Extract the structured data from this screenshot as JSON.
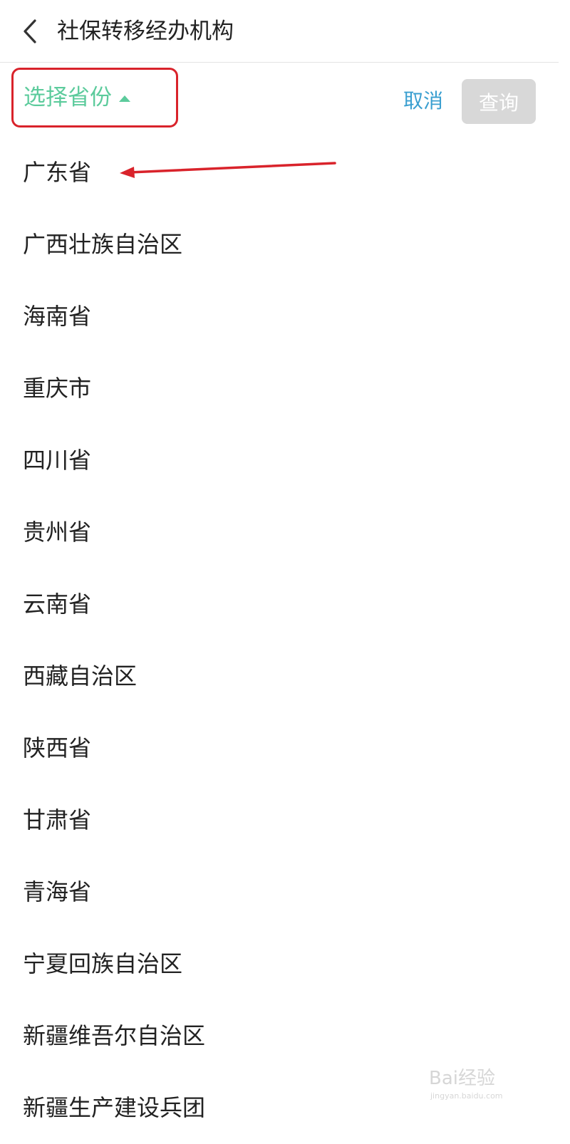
{
  "header": {
    "back_icon": "chevron-left-icon",
    "title": "社保转移经办机构"
  },
  "toolbar": {
    "select_label": "选择省份",
    "select_icon": "caret-up-icon",
    "cancel_label": "取消",
    "query_label": "查询"
  },
  "provinces": [
    "广东省",
    "广西壮族自治区",
    "海南省",
    "重庆市",
    "四川省",
    "贵州省",
    "云南省",
    "西藏自治区",
    "陕西省",
    "甘肃省",
    "青海省",
    "宁夏回族自治区",
    "新疆维吾尔自治区",
    "新疆生产建设兵团"
  ],
  "colors": {
    "accent_green": "#5ccb9c",
    "link_blue": "#3a9fd0",
    "annotation_red": "#d9232b",
    "disabled_button": "#d8d8d8"
  },
  "watermark": {
    "brand": "Bai经验",
    "url": "jingyan.baidu.com"
  }
}
